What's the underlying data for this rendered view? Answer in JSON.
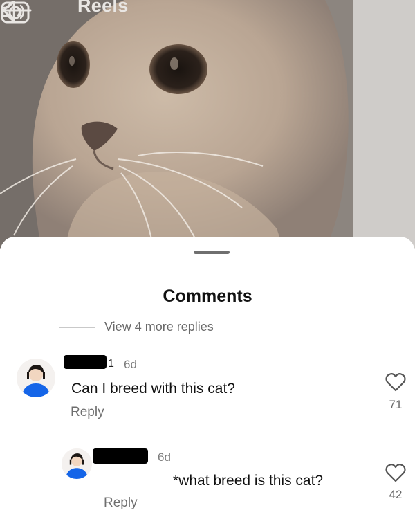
{
  "topbar": {
    "title": "Reels",
    "icons": [
      "back-arrow-icon",
      "speaker-icon",
      "camera-icon"
    ],
    "title_color": "#e9e6e3"
  },
  "video": {
    "content": "close-up of a cream-colored cat"
  },
  "sheet": {
    "title": "Comments",
    "view_more_replies": "View 4 more replies"
  },
  "comments": [
    {
      "username_visible": "1",
      "time": "6d",
      "text": "Can I breed with this cat?",
      "reply_label": "Reply",
      "likes": "71"
    },
    {
      "username_visible": "",
      "time": "6d",
      "text": "*what breed is this cat?",
      "reply_label": "Reply",
      "likes": "42"
    }
  ],
  "colors": {
    "avatar_shirt": "#1565e8",
    "text_primary": "#111111",
    "text_secondary": "#6e6e6e"
  }
}
